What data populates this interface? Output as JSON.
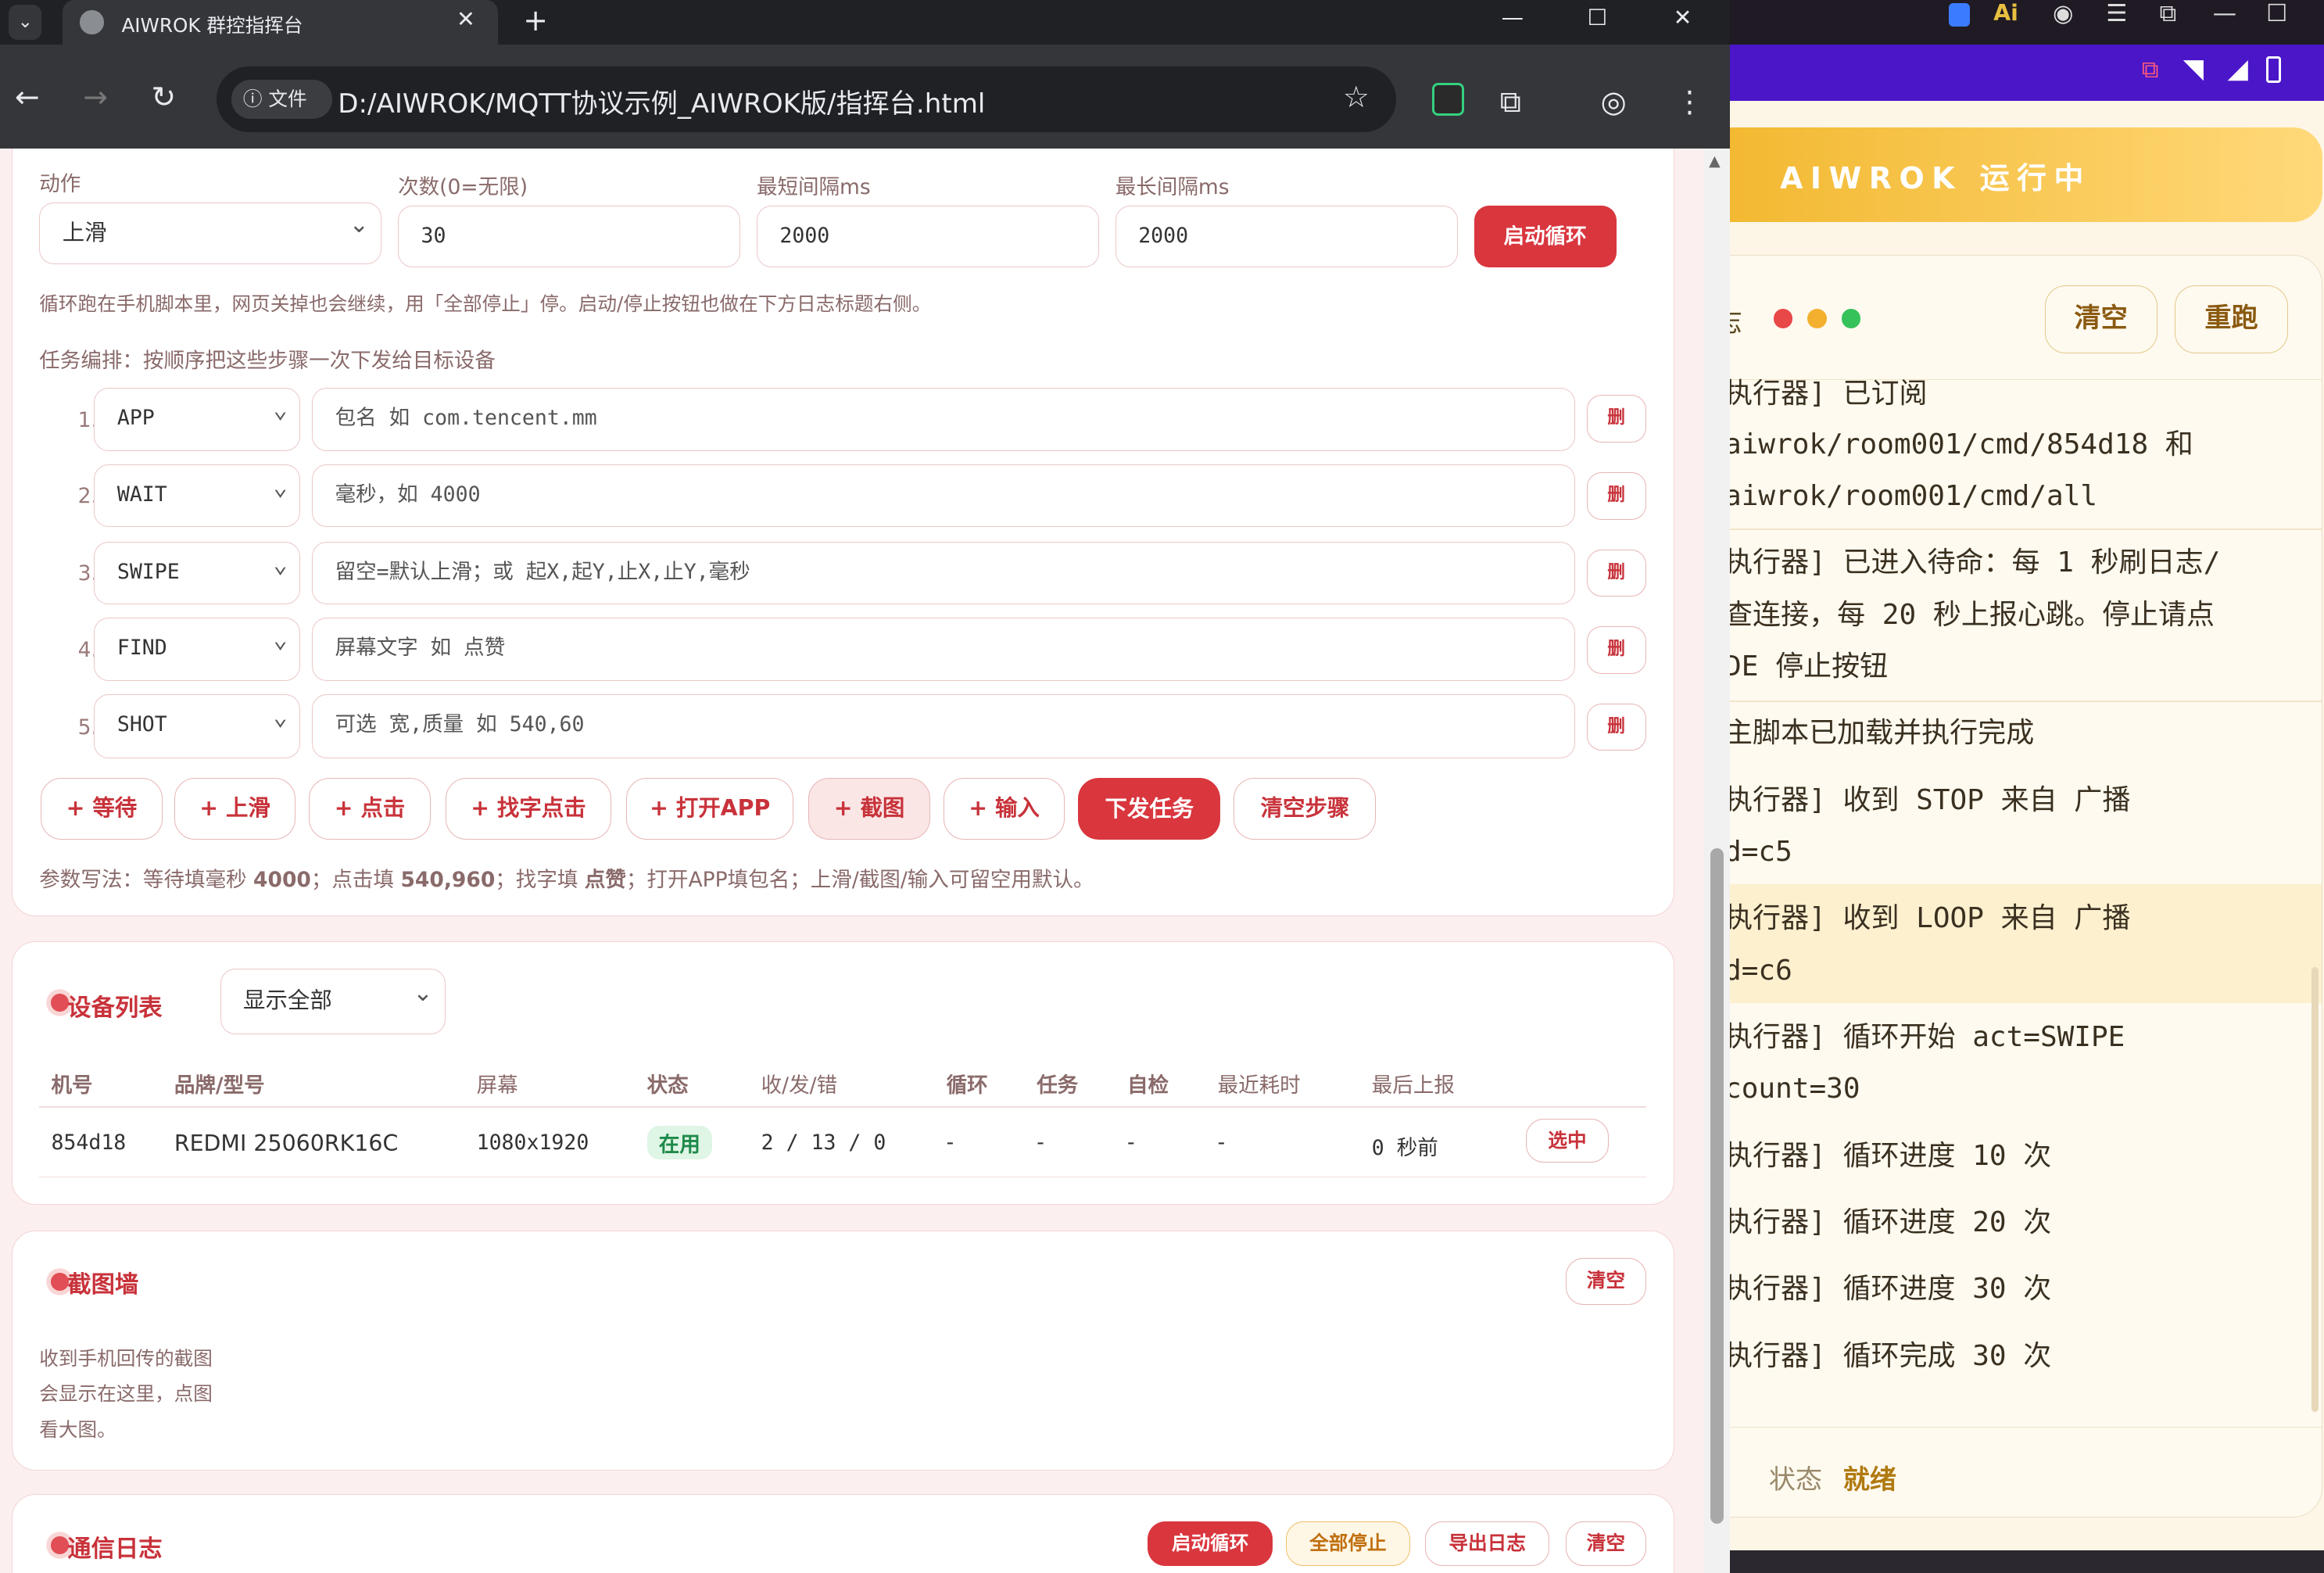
{
  "browser": {
    "tab_title": "AIWROK 群控指挥台",
    "new_tab": "+",
    "close_tab": "✕",
    "window": {
      "minimize": "—",
      "maximize": "☐",
      "close": "✕"
    },
    "info_chip": "ⓘ 文件",
    "url": "D:/AIWROK/MQTT协议示例_AIWROK版/指挥台.html",
    "nav": {
      "back": "←",
      "forward": "→",
      "reload": "↻"
    },
    "bookmark": "☆"
  },
  "loop": {
    "labels": {
      "action": "动作",
      "count": "次数(0=无限)",
      "min": "最短间隔ms",
      "max": "最长间隔ms"
    },
    "action_value": "上滑",
    "count_value": "30",
    "min_value": "2000",
    "max_value": "2000",
    "start_btn": "启动循环",
    "note": "循环跑在手机脚本里，网页关掉也会继续，用「全部停止」停。启动/停止按钮也做在下方日志标题右侧。"
  },
  "task": {
    "heading": "任务编排：按顺序把这些步骤一次下发给目标设备",
    "steps": [
      {
        "num": "1.",
        "type": "APP",
        "placeholder": "包名 如 com.tencent.mm"
      },
      {
        "num": "2.",
        "type": "WAIT",
        "placeholder": "毫秒，如 4000"
      },
      {
        "num": "3.",
        "type": "SWIPE",
        "placeholder": "留空=默认上滑；或 起X,起Y,止X,止Y,毫秒"
      },
      {
        "num": "4.",
        "type": "FIND",
        "placeholder": "屏幕文字 如 点赞"
      },
      {
        "num": "5.",
        "type": "SHOT",
        "placeholder": "可选 宽,质量 如 540,60"
      }
    ],
    "del_label": "删",
    "add_buttons": [
      "+ 等待",
      "+ 上滑",
      "+ 点击",
      "+ 找字点击",
      "+ 打开APP",
      "+ 截图",
      "+ 输入"
    ],
    "send_btn": "下发任务",
    "clear_btn": "清空步骤",
    "tip": {
      "t1": "参数写法：等待填毫秒 ",
      "b1": "4000",
      "t2": "；点击填 ",
      "b2": "540,960",
      "t3": "；找字填 ",
      "b3": "点赞",
      "t4": "；打开APP填包名；上滑/截图/输入可留空用默认。"
    }
  },
  "devices": {
    "title": "设备列表",
    "filter": "显示全部",
    "columns": [
      "机号",
      "品牌/型号",
      "屏幕",
      "状态",
      "收/发/错",
      "循环",
      "任务",
      "自检",
      "最近耗时",
      "最后上报"
    ],
    "row": {
      "id": "854d18",
      "model": "REDMI 25060RK16C",
      "screen": "1080x1920",
      "status": "在用",
      "stats": "2 / 13 / 0",
      "loop": "-",
      "task": "-",
      "check": "-",
      "latency": "-",
      "last": "0 秒前",
      "action": "选中"
    }
  },
  "shots": {
    "title": "截图墙",
    "clear": "清空",
    "empty": [
      "收到手机回传的截图",
      "会显示在这里，点图",
      "看大图。"
    ]
  },
  "log": {
    "title": "通信日志",
    "start": "启动循环",
    "stop": "全部停止",
    "export": "导出日志",
    "clear": "清空"
  },
  "phone": {
    "banner": "AIWROK 运行中",
    "console_tab": "志",
    "clear": "清空",
    "rerun": "重跑",
    "lines": [
      "执行器] 已订阅",
      "aiwrok/room001/cmd/854d18 和",
      "aiwrok/room001/cmd/all",
      "执行器] 已进入待命：每 1 秒刷日志/",
      "查连接，每 20 秒上报心跳。停止请点",
      "DE 停止按钮",
      "主脚本已加载并执行完成",
      "执行器] 收到 STOP 来自 广播",
      "d=c5",
      "执行器] 收到 LOOP 来自 广播",
      "d=c6",
      "执行器] 循环开始 act=SWIPE",
      "count=30",
      "执行器] 循环进度 10 次",
      "执行器] 循环进度 20 次",
      "执行器] 循环进度 30 次",
      "执行器] 循环完成 30 次"
    ],
    "status_label": "状态",
    "status_value": "就绪"
  },
  "colors": {
    "accent": "#d9363e",
    "page_bg": "#fcefef",
    "status_green": "#1e8a4a",
    "phone_banner": "#f2b72e"
  }
}
